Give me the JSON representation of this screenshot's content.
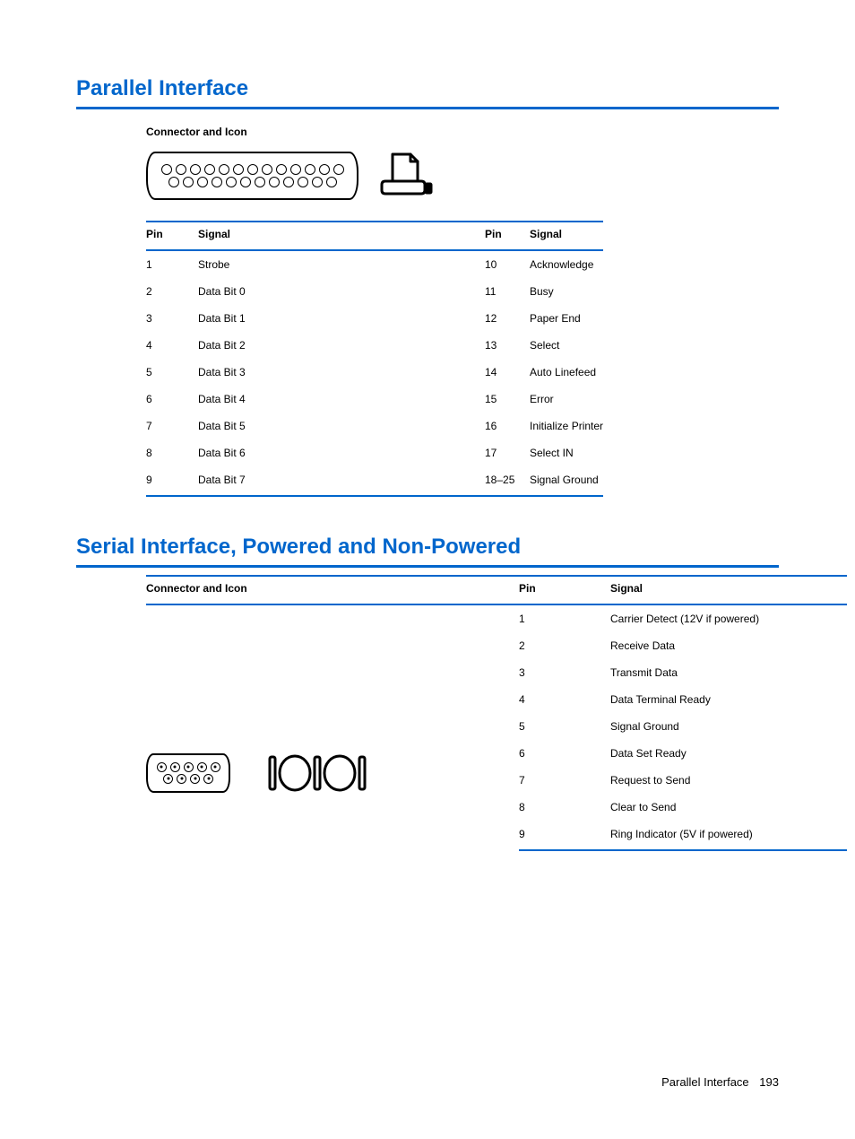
{
  "section1": {
    "heading": "Parallel Interface",
    "caption": "Connector and Icon",
    "headers": {
      "pin": "Pin",
      "signal": "Signal"
    },
    "left": [
      {
        "pin": "1",
        "signal": "Strobe"
      },
      {
        "pin": "2",
        "signal": "Data Bit 0"
      },
      {
        "pin": "3",
        "signal": "Data Bit 1"
      },
      {
        "pin": "4",
        "signal": "Data Bit 2"
      },
      {
        "pin": "5",
        "signal": "Data Bit 3"
      },
      {
        "pin": "6",
        "signal": "Data Bit 4"
      },
      {
        "pin": "7",
        "signal": "Data Bit 5"
      },
      {
        "pin": "8",
        "signal": "Data Bit 6"
      },
      {
        "pin": "9",
        "signal": "Data Bit 7"
      }
    ],
    "right": [
      {
        "pin": "10",
        "signal": "Acknowledge"
      },
      {
        "pin": "11",
        "signal": "Busy"
      },
      {
        "pin": "12",
        "signal": "Paper End"
      },
      {
        "pin": "13",
        "signal": "Select"
      },
      {
        "pin": "14",
        "signal": "Auto Linefeed"
      },
      {
        "pin": "15",
        "signal": "Error"
      },
      {
        "pin": "16",
        "signal": "Initialize Printer"
      },
      {
        "pin": "17",
        "signal": "Select IN"
      },
      {
        "pin": "18–25",
        "signal": "Signal Ground"
      }
    ]
  },
  "section2": {
    "heading": "Serial Interface, Powered and Non-Powered",
    "headers": {
      "icon": "Connector and Icon",
      "pin": "Pin",
      "signal": "Signal"
    },
    "rows": [
      {
        "pin": "1",
        "signal": "Carrier Detect (12V if powered)"
      },
      {
        "pin": "2",
        "signal": "Receive Data"
      },
      {
        "pin": "3",
        "signal": "Transmit Data"
      },
      {
        "pin": "4",
        "signal": "Data Terminal Ready"
      },
      {
        "pin": "5",
        "signal": "Signal Ground"
      },
      {
        "pin": "6",
        "signal": "Data Set Ready"
      },
      {
        "pin": "7",
        "signal": "Request to Send"
      },
      {
        "pin": "8",
        "signal": "Clear to Send"
      },
      {
        "pin": "9",
        "signal": "Ring Indicator (5V if powered)"
      }
    ]
  },
  "footer": {
    "title": "Parallel Interface",
    "page": "193"
  }
}
